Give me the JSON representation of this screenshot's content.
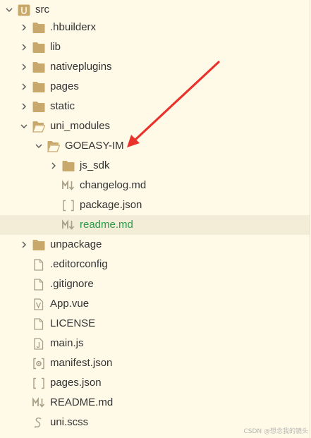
{
  "colors": {
    "background": "#fffae8",
    "selected_row": "#f3ecd7",
    "folder": "#c9a96b",
    "file_icon": "#a89f86",
    "text": "#333333",
    "active_text": "#2b9a4a",
    "arrow": "#e8322b"
  },
  "tree": {
    "src": {
      "label": "src",
      "icon": "uni-project-icon"
    },
    "hbuilderx": {
      "label": ".hbuilderx"
    },
    "lib": {
      "label": "lib"
    },
    "nativeplugins": {
      "label": "nativeplugins"
    },
    "pages": {
      "label": "pages"
    },
    "static": {
      "label": "static"
    },
    "uni_modules": {
      "label": "uni_modules"
    },
    "goeasy_im": {
      "label": "GOEASY-IM"
    },
    "js_sdk": {
      "label": "js_sdk"
    },
    "changelog": {
      "label": "changelog.md",
      "icon": "markdown-icon"
    },
    "package_json": {
      "label": "package.json",
      "icon": "json-icon"
    },
    "readme_md": {
      "label": "readme.md",
      "icon": "markdown-icon"
    },
    "unpackage": {
      "label": "unpackage"
    },
    "editorconfig": {
      "label": ".editorconfig",
      "icon": "file-icon"
    },
    "gitignore": {
      "label": ".gitignore",
      "icon": "file-icon"
    },
    "app_vue": {
      "label": "App.vue",
      "icon": "vue-file-icon"
    },
    "license": {
      "label": "LICENSE",
      "icon": "file-icon"
    },
    "main_js": {
      "label": "main.js",
      "icon": "js-file-icon"
    },
    "manifest_json": {
      "label": "manifest.json",
      "icon": "settings-file-icon"
    },
    "pages_json": {
      "label": "pages.json",
      "icon": "json-icon"
    },
    "readme_root": {
      "label": "README.md",
      "icon": "markdown-icon"
    },
    "uni_scss": {
      "label": "uni.scss",
      "icon": "scss-file-icon"
    }
  },
  "watermark": "CSDN @想念我的镜头"
}
